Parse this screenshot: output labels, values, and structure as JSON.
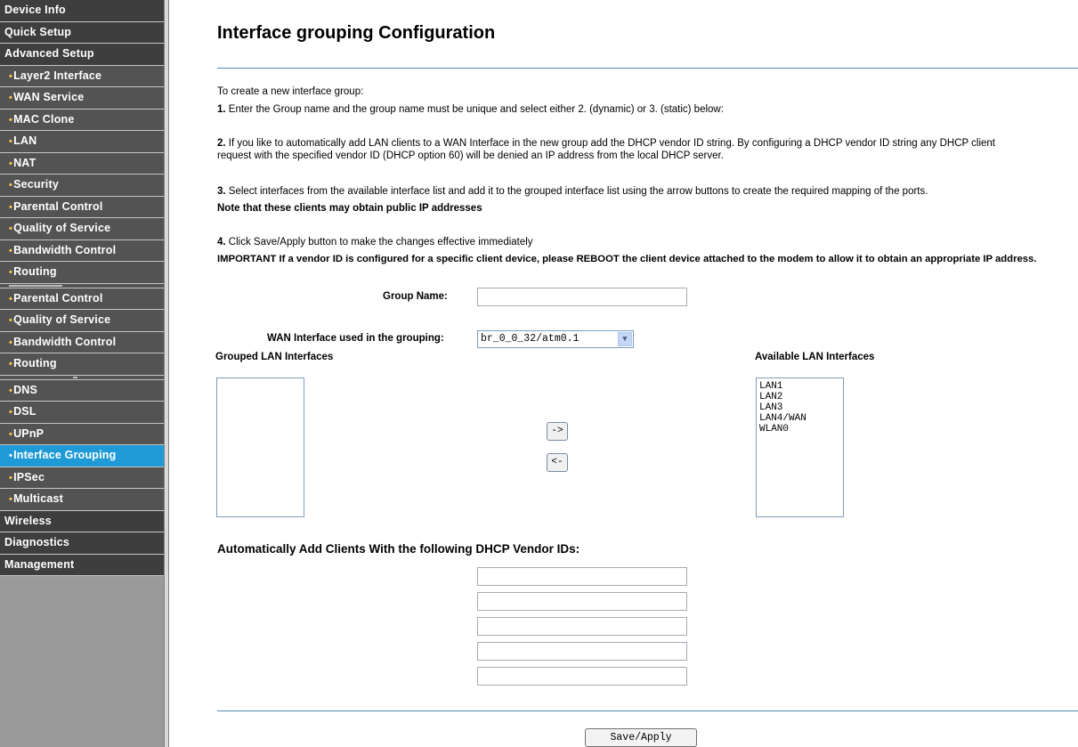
{
  "sidebar": {
    "items": [
      {
        "label": "Device Info",
        "kind": "main"
      },
      {
        "label": "Quick Setup",
        "kind": "main"
      },
      {
        "label": "Advanced Setup",
        "kind": "main"
      },
      {
        "label": "Layer2 Interface",
        "kind": "sub"
      },
      {
        "label": "WAN Service",
        "kind": "sub"
      },
      {
        "label": "MAC Clone",
        "kind": "sub"
      },
      {
        "label": "LAN",
        "kind": "sub"
      },
      {
        "label": "NAT",
        "kind": "sub"
      },
      {
        "label": "Security",
        "kind": "sub"
      },
      {
        "label": "Parental Control",
        "kind": "sub"
      },
      {
        "label": "Quality of Service",
        "kind": "sub"
      },
      {
        "label": "Bandwidth Control",
        "kind": "sub"
      },
      {
        "label": "Routing",
        "kind": "sub"
      },
      {
        "label": "Parental Control",
        "kind": "sub"
      },
      {
        "label": "Quality of Service",
        "kind": "sub"
      },
      {
        "label": "Bandwidth Control",
        "kind": "sub"
      },
      {
        "label": "Routing",
        "kind": "sub"
      },
      {
        "label": "DNS",
        "kind": "sub"
      },
      {
        "label": "DSL",
        "kind": "sub"
      },
      {
        "label": "UPnP",
        "kind": "sub"
      },
      {
        "label": "Interface Grouping",
        "kind": "sub",
        "active": true
      },
      {
        "label": "IPSec",
        "kind": "sub"
      },
      {
        "label": "Multicast",
        "kind": "sub"
      },
      {
        "label": "Wireless",
        "kind": "main"
      },
      {
        "label": "Diagnostics",
        "kind": "main"
      },
      {
        "label": "Management",
        "kind": "main"
      }
    ],
    "bullet": "•",
    "active_color": "#1e9ad7"
  },
  "main": {
    "title": "Interface grouping Configuration",
    "intro": "To create a new interface group:",
    "step1_num": "1.",
    "step1": " Enter the Group name and the group name must be unique and select either 2. (dynamic) or 3. (static) below:",
    "step2_num": "2.",
    "step2_line1": " If you like to automatically add LAN clients to a WAN Interface in the new group add the DHCP vendor ID string. By configuring a DHCP vendor ID string any DHCP client",
    "step2_line2": "request with the specified vendor ID (DHCP option 60) will be denied an IP address from the local DHCP server.",
    "step3_num": "3.",
    "step3": " Select interfaces from the available interface list and add it to the grouped interface list using the arrow buttons to create the required mapping of the ports.",
    "note": "Note that these clients may obtain public IP addresses",
    "step4_num": "4.",
    "step4": " Click Save/Apply button to make the changes effective immediately",
    "important": "IMPORTANT If a vendor ID is configured for a specific client device, please REBOOT the client device attached to the modem to allow it to obtain an appropriate IP address.",
    "group_name_label": "Group Name:",
    "group_name_value": "",
    "wan_label": "WAN Interface used in the grouping:",
    "wan_selected": "br_0_0_32/atm0.1",
    "grouped_label": "Grouped LAN Interfaces",
    "available_label": "Available LAN Interfaces",
    "grouped_items": [],
    "available_items": [
      "LAN1",
      "LAN2",
      "LAN3",
      "LAN4/WAN",
      "WLAN0"
    ],
    "add_button": "->",
    "remove_button": "<-",
    "vendor_title": "Automatically Add Clients With the following DHCP Vendor IDs:",
    "vendor_ids": [
      "",
      "",
      "",
      "",
      ""
    ],
    "save_button": "Save/Apply"
  },
  "colors": {
    "sidebar_main": "#3e3e3e",
    "sidebar_sub": "#535353",
    "bullet": "#f6c64a",
    "rule": "#4a8bb5"
  }
}
